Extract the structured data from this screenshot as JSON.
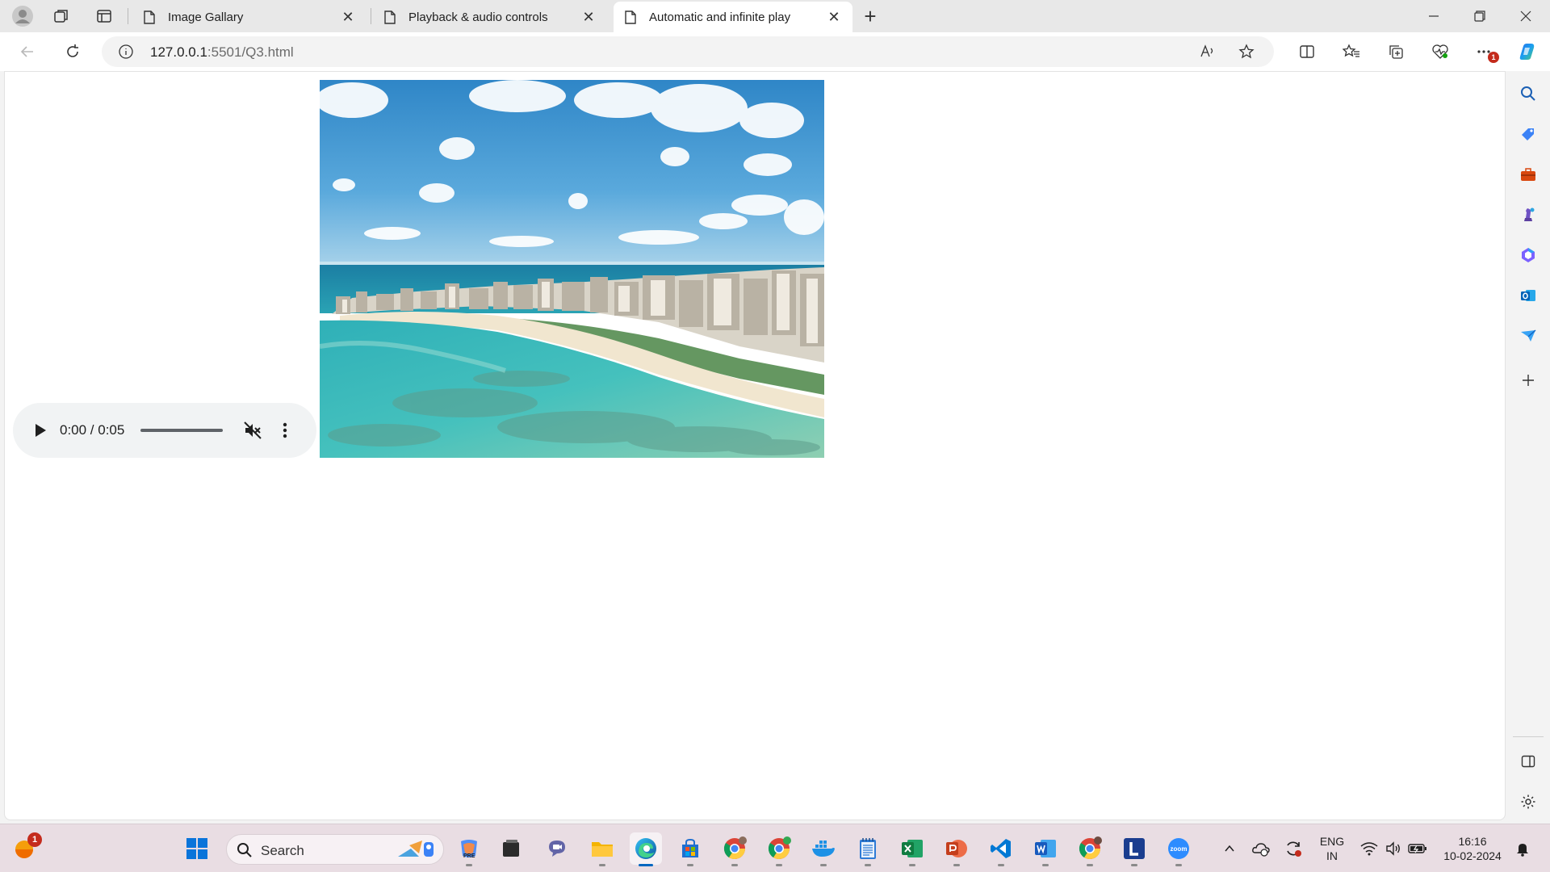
{
  "browser": {
    "tabs": [
      {
        "title": "Image Gallary",
        "active": false
      },
      {
        "title": "Playback & audio controls",
        "active": false
      },
      {
        "title": "Automatic and infinite play",
        "active": true
      }
    ],
    "address": {
      "host": "127.0.0.1",
      "path": ":5501/Q3.html"
    },
    "notification_count": "1"
  },
  "page": {
    "audio": {
      "time": "0:00 / 0:05",
      "progress": 0,
      "muted": true
    },
    "image": {
      "description_icon": "beach-city-aerial-photo"
    }
  },
  "taskbar": {
    "search_placeholder": "Search",
    "language": {
      "line1": "ENG",
      "line2": "IN"
    },
    "clock": {
      "time": "16:16",
      "date": "10-02-2024"
    },
    "start_badge": "1"
  },
  "colors": {
    "accent": "#0067c0",
    "taskbar_bg": "#e9dde3"
  }
}
